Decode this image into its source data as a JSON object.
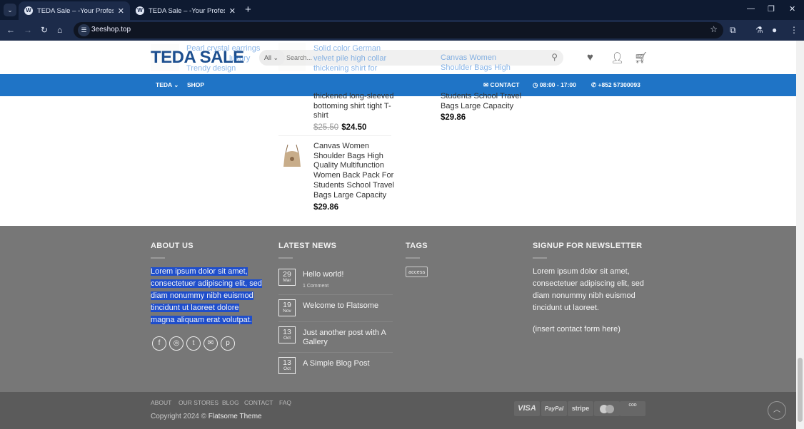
{
  "browser": {
    "tabs": [
      {
        "title": "TEDA Sale – -Your Professional"
      },
      {
        "title": "TEDA Sale – -Your Professional"
      }
    ],
    "url": "3eeshop.top"
  },
  "header": {
    "logo": "TEDA SALE",
    "search_category": "All",
    "search_placeholder": "Search...",
    "nav": [
      "TEDA",
      "SHOP"
    ],
    "contact": "CONTACT",
    "hours": "08:00 - 17:00",
    "phone": "+852 57300093"
  },
  "behind_header": {
    "left": [
      "Pearl crystal earrings",
      "luxury",
      "Trendy design"
    ],
    "middle": [
      "Solid color German",
      "velvet pile high collar",
      "thickening shirt for"
    ],
    "right": [
      "Canvas Women",
      "Shoulder Bags High"
    ]
  },
  "products": [
    {
      "title_tail": "thickened long-sleeved bottoming shirt tight T-shirt",
      "old_price": "$25.50",
      "price": "$24.50"
    },
    {
      "title": "Canvas Women Shoulder Bags High Quality Multifunction Women Back Pack For Students School Travel Bags Large Capacity",
      "price": "$29.86"
    },
    {
      "title_tail": "Students School Travel Bags Large Capacity",
      "price": "$29.86"
    }
  ],
  "footer": {
    "about": {
      "heading": "ABOUT US",
      "text": "Lorem ipsum dolor sit amet, consectetuer adipiscing elit, sed diam nonummy nibh euismod tincidunt ut laoreet dolore magna aliquam erat volutpat."
    },
    "news": {
      "heading": "LATEST NEWS",
      "posts": [
        {
          "day": "29",
          "month": "Mar",
          "title": "Hello world!",
          "meta": "1 Comment"
        },
        {
          "day": "19",
          "month": "Nov",
          "title": "Welcome to Flatsome"
        },
        {
          "day": "13",
          "month": "Oct",
          "title": "Just another post with A Gallery"
        },
        {
          "day": "13",
          "month": "Oct",
          "title": "A Simple Blog Post"
        }
      ]
    },
    "tags": {
      "heading": "TAGS",
      "items": [
        "access"
      ]
    },
    "newsletter": {
      "heading": "SIGNUP FOR NEWSLETTER",
      "text": "Lorem ipsum dolor sit amet, consectetuer adipiscing elit, sed diam nonummy nibh euismod tincidunt ut laoreet.",
      "form": "(insert contact form here)"
    },
    "links": [
      "ABOUT",
      "OUR STORES",
      "BLOG",
      "CONTACT",
      "FAQ"
    ],
    "copyright_prefix": "Copyright 2024 ©",
    "copyright_brand": "Flatsome Theme",
    "payments": [
      "VISA",
      "PayPal",
      "stripe",
      "MC",
      "COD"
    ]
  }
}
